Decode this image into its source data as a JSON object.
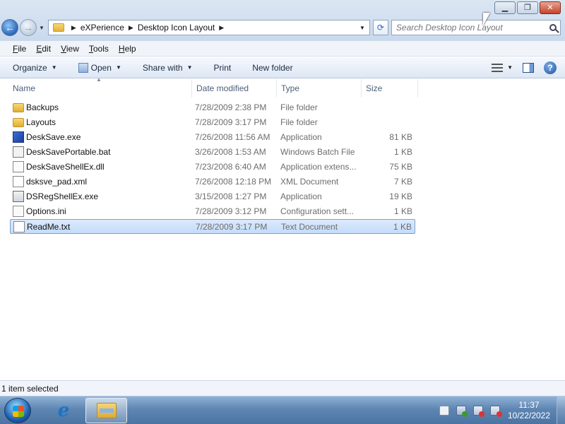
{
  "window": {
    "controls": {
      "minimize": "▁",
      "maximize": "❐",
      "close": "✕"
    }
  },
  "nav": {
    "back": "←",
    "forward": "→",
    "breadcrumb": [
      "eXPerience",
      "Desktop Icon Layout"
    ],
    "search_placeholder": "Search Desktop Icon Layout"
  },
  "menu": [
    {
      "acc": "F",
      "rest": "ile"
    },
    {
      "acc": "E",
      "rest": "dit"
    },
    {
      "acc": "V",
      "rest": "iew"
    },
    {
      "acc": "T",
      "rest": "ools"
    },
    {
      "acc": "H",
      "rest": "elp"
    }
  ],
  "toolbar": {
    "organize": "Organize",
    "open": "Open",
    "share_with": "Share with",
    "print": "Print",
    "new_folder": "New folder",
    "help": "?"
  },
  "columns": {
    "name": "Name",
    "date": "Date modified",
    "type": "Type",
    "size": "Size"
  },
  "files": [
    {
      "name": "Backups",
      "date": "7/28/2009 2:38 PM",
      "type": "File folder",
      "size": "",
      "icon": "folder-icon"
    },
    {
      "name": "Layouts",
      "date": "7/28/2009 3:17 PM",
      "type": "File folder",
      "size": "",
      "icon": "folder-icon"
    },
    {
      "name": "DeskSave.exe",
      "date": "7/26/2008 11:56 AM",
      "type": "Application",
      "size": "81 KB",
      "icon": "application-icon"
    },
    {
      "name": "DeskSavePortable.bat",
      "date": "3/26/2008 1:53 AM",
      "type": "Windows Batch File",
      "size": "1 KB",
      "icon": "batch-file-icon"
    },
    {
      "name": "DeskSaveShellEx.dll",
      "date": "7/23/2008 6:40 AM",
      "type": "Application extens...",
      "size": "75 KB",
      "icon": "dll-file-icon"
    },
    {
      "name": "dsksve_pad.xml",
      "date": "7/26/2008 12:18 PM",
      "type": "XML Document",
      "size": "7 KB",
      "icon": "xml-file-icon"
    },
    {
      "name": "DSRegShellEx.exe",
      "date": "3/15/2008 1:27 PM",
      "type": "Application",
      "size": "19 KB",
      "icon": "exe-file-icon"
    },
    {
      "name": "Options.ini",
      "date": "7/28/2009 3:12 PM",
      "type": "Configuration sett...",
      "size": "1 KB",
      "icon": "ini-file-icon"
    },
    {
      "name": "ReadMe.txt",
      "date": "7/28/2009 3:17 PM",
      "type": "Text Document",
      "size": "1 KB",
      "icon": "text-file-icon",
      "selected": true
    }
  ],
  "status": {
    "text": "1 item selected"
  },
  "taskbar": {
    "time": "11:37",
    "date": "10/22/2022",
    "ie_label": "e"
  }
}
